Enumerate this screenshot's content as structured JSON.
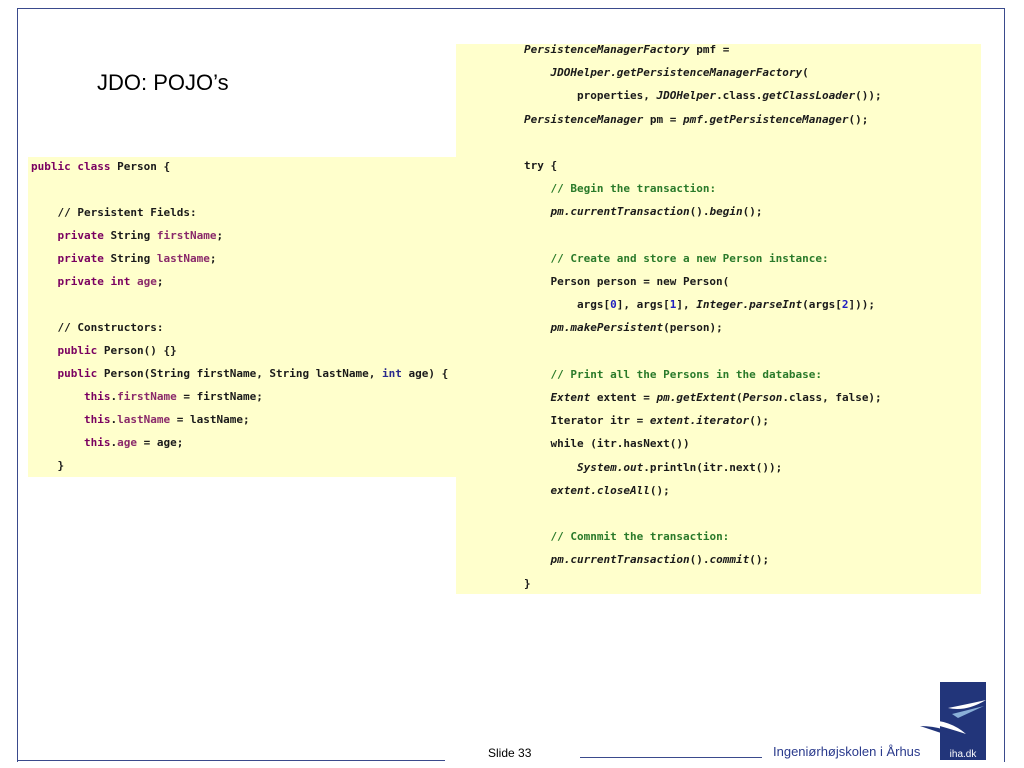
{
  "slide": {
    "title": "JDO: POJO’s",
    "slide_number": "Slide 33",
    "organization": "Ingeniørhøjskolen i Århus",
    "logo_text": "iha.dk"
  },
  "code_left": [
    [
      {
        "t": "public class",
        "c": "kw"
      },
      {
        "t": " Person {"
      }
    ],
    [],
    [
      {
        "t": "    // Persistent Fields:"
      }
    ],
    [
      {
        "t": "    "
      },
      {
        "t": "private",
        "c": "kw"
      },
      {
        "t": " String "
      },
      {
        "t": "firstName",
        "c": "field"
      },
      {
        "t": ";"
      }
    ],
    [
      {
        "t": "    "
      },
      {
        "t": "private",
        "c": "kw"
      },
      {
        "t": " String "
      },
      {
        "t": "lastName",
        "c": "field"
      },
      {
        "t": ";"
      }
    ],
    [
      {
        "t": "    "
      },
      {
        "t": "private int",
        "c": "kw"
      },
      {
        "t": " "
      },
      {
        "t": "age",
        "c": "field"
      },
      {
        "t": ";"
      }
    ],
    [],
    [
      {
        "t": "    // Constructors:"
      }
    ],
    [
      {
        "t": "    "
      },
      {
        "t": "public",
        "c": "kw"
      },
      {
        "t": " Person() {}"
      }
    ],
    [
      {
        "t": "    "
      },
      {
        "t": "public",
        "c": "kw"
      },
      {
        "t": " Person(String firstName, String lastName, "
      },
      {
        "t": "int",
        "c": "kw2"
      },
      {
        "t": " age) {"
      }
    ],
    [
      {
        "t": "        "
      },
      {
        "t": "this",
        "c": "kw"
      },
      {
        "t": "."
      },
      {
        "t": "firstName",
        "c": "field"
      },
      {
        "t": " = firstName;"
      }
    ],
    [
      {
        "t": "        "
      },
      {
        "t": "this",
        "c": "kw"
      },
      {
        "t": "."
      },
      {
        "t": "lastName",
        "c": "field"
      },
      {
        "t": " = lastName;"
      }
    ],
    [
      {
        "t": "        "
      },
      {
        "t": "this",
        "c": "kw"
      },
      {
        "t": "."
      },
      {
        "t": "age",
        "c": "field"
      },
      {
        "t": " = age;"
      }
    ],
    [
      {
        "t": "    }"
      }
    ]
  ],
  "code_right": [
    [
      {
        "t": "PersistenceManagerFactory",
        "c": "it"
      },
      {
        "t": " pmf ="
      }
    ],
    [
      {
        "t": "    "
      },
      {
        "t": "JDOHelper.getPersistenceManagerFactory",
        "c": "it"
      },
      {
        "t": "("
      }
    ],
    [
      {
        "t": "        properties, "
      },
      {
        "t": "JDOHelper",
        "c": "it"
      },
      {
        "t": ".class."
      },
      {
        "t": "getClassLoader",
        "c": "it"
      },
      {
        "t": "());"
      }
    ],
    [
      {
        "t": "PersistenceManager",
        "c": "it"
      },
      {
        "t": " pm = "
      },
      {
        "t": "pmf.getPersistenceManager",
        "c": "it"
      },
      {
        "t": "();"
      }
    ],
    [],
    [
      {
        "t": "try {"
      }
    ],
    [
      {
        "t": "    "
      },
      {
        "t": "// Begin the transaction:",
        "c": "comment"
      }
    ],
    [
      {
        "t": "    "
      },
      {
        "t": "pm.currentTransaction",
        "c": "it"
      },
      {
        "t": "()."
      },
      {
        "t": "begin",
        "c": "it"
      },
      {
        "t": "();"
      }
    ],
    [],
    [
      {
        "t": "    "
      },
      {
        "t": "// Create and store a new Person instance:",
        "c": "comment"
      }
    ],
    [
      {
        "t": "    Person person = new Person("
      }
    ],
    [
      {
        "t": "        args["
      },
      {
        "t": "0",
        "c": "num"
      },
      {
        "t": "], args["
      },
      {
        "t": "1",
        "c": "num"
      },
      {
        "t": "], "
      },
      {
        "t": "Integer.parseInt",
        "c": "it"
      },
      {
        "t": "(args["
      },
      {
        "t": "2",
        "c": "num"
      },
      {
        "t": "]));"
      }
    ],
    [
      {
        "t": "    "
      },
      {
        "t": "pm.makePersistent",
        "c": "it"
      },
      {
        "t": "(person);"
      }
    ],
    [],
    [
      {
        "t": "    "
      },
      {
        "t": "// Print all the Persons in the database:",
        "c": "comment"
      }
    ],
    [
      {
        "t": "    "
      },
      {
        "t": "Extent",
        "c": "it"
      },
      {
        "t": " extent = "
      },
      {
        "t": "pm.getExtent",
        "c": "it"
      },
      {
        "t": "("
      },
      {
        "t": "Person",
        "c": "it"
      },
      {
        "t": ".class, false);"
      }
    ],
    [
      {
        "t": "    Iterator itr = "
      },
      {
        "t": "extent.iterator",
        "c": "it"
      },
      {
        "t": "();"
      }
    ],
    [
      {
        "t": "    while (itr.hasNext())"
      }
    ],
    [
      {
        "t": "        "
      },
      {
        "t": "System.out",
        "c": "it"
      },
      {
        "t": ".println(itr.next());"
      }
    ],
    [
      {
        "t": "    "
      },
      {
        "t": "extent.closeAll",
        "c": "it"
      },
      {
        "t": "();"
      }
    ],
    [],
    [
      {
        "t": "    "
      },
      {
        "t": "// Comnmit the transaction:",
        "c": "comment"
      }
    ],
    [
      {
        "t": "    "
      },
      {
        "t": "pm.currentTransaction",
        "c": "it"
      },
      {
        "t": "()."
      },
      {
        "t": "commit",
        "c": "it"
      },
      {
        "t": "();"
      }
    ],
    [
      {
        "t": "}"
      }
    ]
  ],
  "colors": {
    "frame": "#3a4a8c",
    "code_background": "#ffffcc",
    "keyword": "#7a0060",
    "comment": "#2a7a2a",
    "logo_blue": "#22357a"
  }
}
